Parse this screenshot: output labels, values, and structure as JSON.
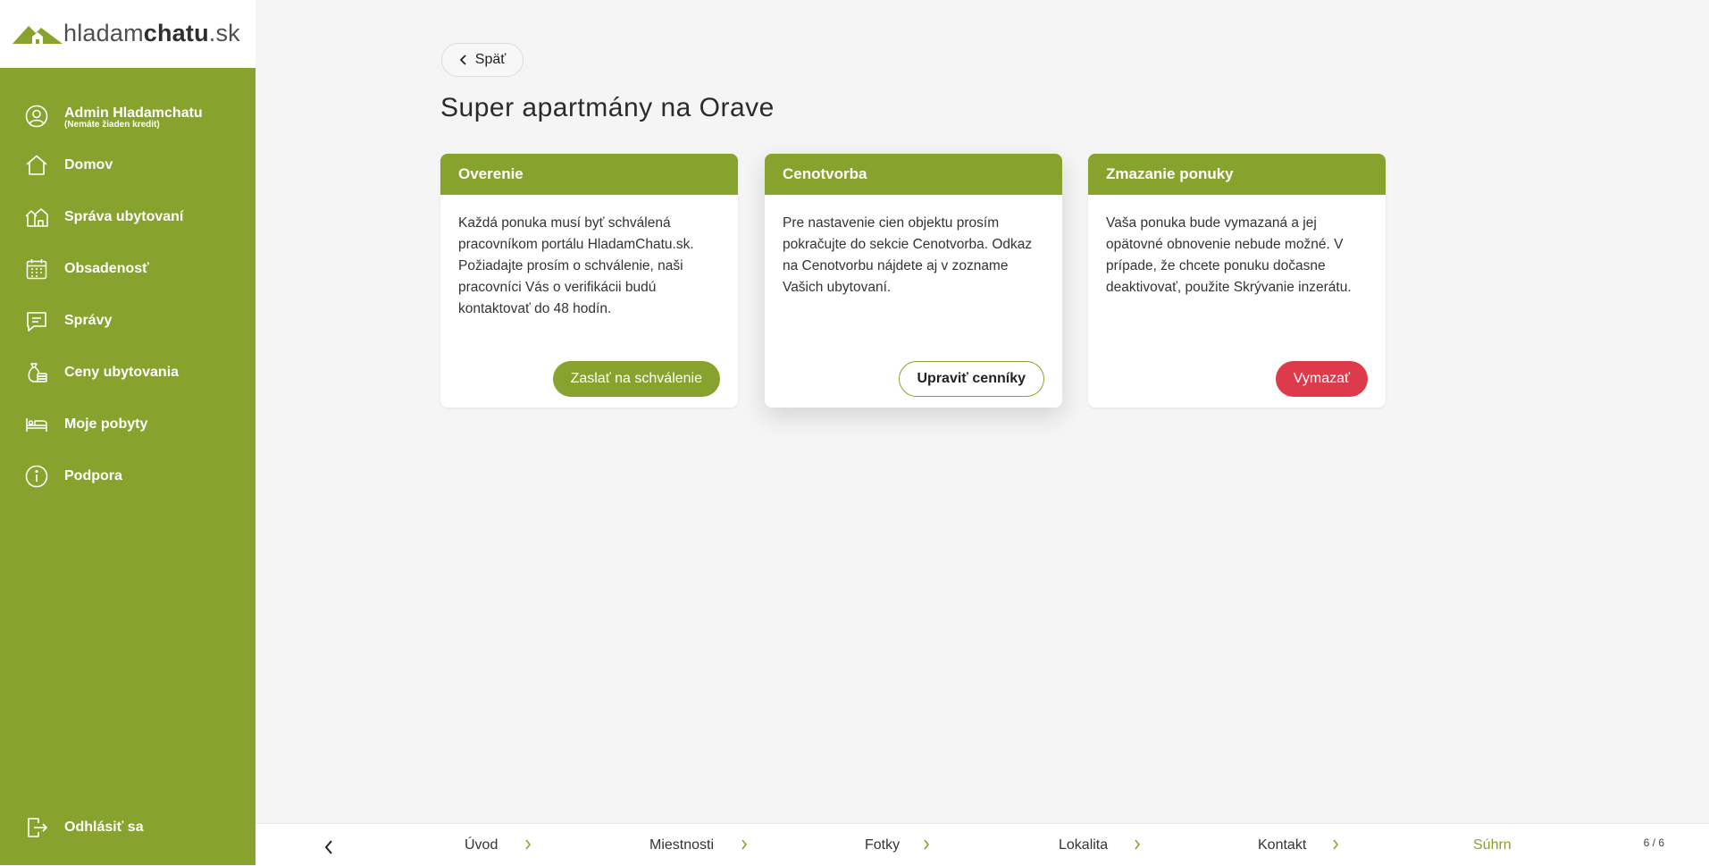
{
  "logo": {
    "part1": "hladam",
    "part2": "chatu",
    "part3": ".sk"
  },
  "user": {
    "name": "Admin Hladamchatu",
    "subtitle": "(Nemáte žiaden kredit)"
  },
  "nav": {
    "home": "Domov",
    "accommodation": "Správa ubytovaní",
    "occupancy": "Obsadenosť",
    "messages": "Správy",
    "prices": "Ceny ubytovania",
    "stays": "Moje pobyty",
    "support": "Podpora",
    "logout": "Odhlásiť sa"
  },
  "back_label": "Späť",
  "page_title": "Super apartmány na Orave",
  "cards": [
    {
      "title": "Overenie",
      "text": "Každá ponuka musí byť schválená pracovníkom portálu HladamChatu.sk. Požiadajte prosím o schválenie, naši pracovníci Vás o verifikácii budú kontaktovať do 48 hodín.",
      "button": "Zaslať na schválenie"
    },
    {
      "title": "Cenotvorba",
      "text": "Pre nastavenie cien objektu prosím pokračujte do sekcie Cenotvorba. Odkaz na Cenotvorbu nájdete aj v zozname Vašich ubytovaní.",
      "button": "Upraviť cenníky"
    },
    {
      "title": "Zmazanie ponuky",
      "text": "Vaša ponuka bude vymazaná a jej opätovné obnovenie nebude možné. V prípade, že chcete ponuku dočasne deaktivovať, použite Skrývanie inzerátu.",
      "button": "Vymazať"
    }
  ],
  "steps": {
    "intro": "Úvod",
    "rooms": "Miestnosti",
    "photos": "Fotky",
    "location": "Lokalita",
    "contact": "Kontakt",
    "summary": "Súhrn"
  },
  "step_counter": "6 / 6",
  "colors": {
    "brand": "#88a22e",
    "danger": "#dd3a4b"
  }
}
